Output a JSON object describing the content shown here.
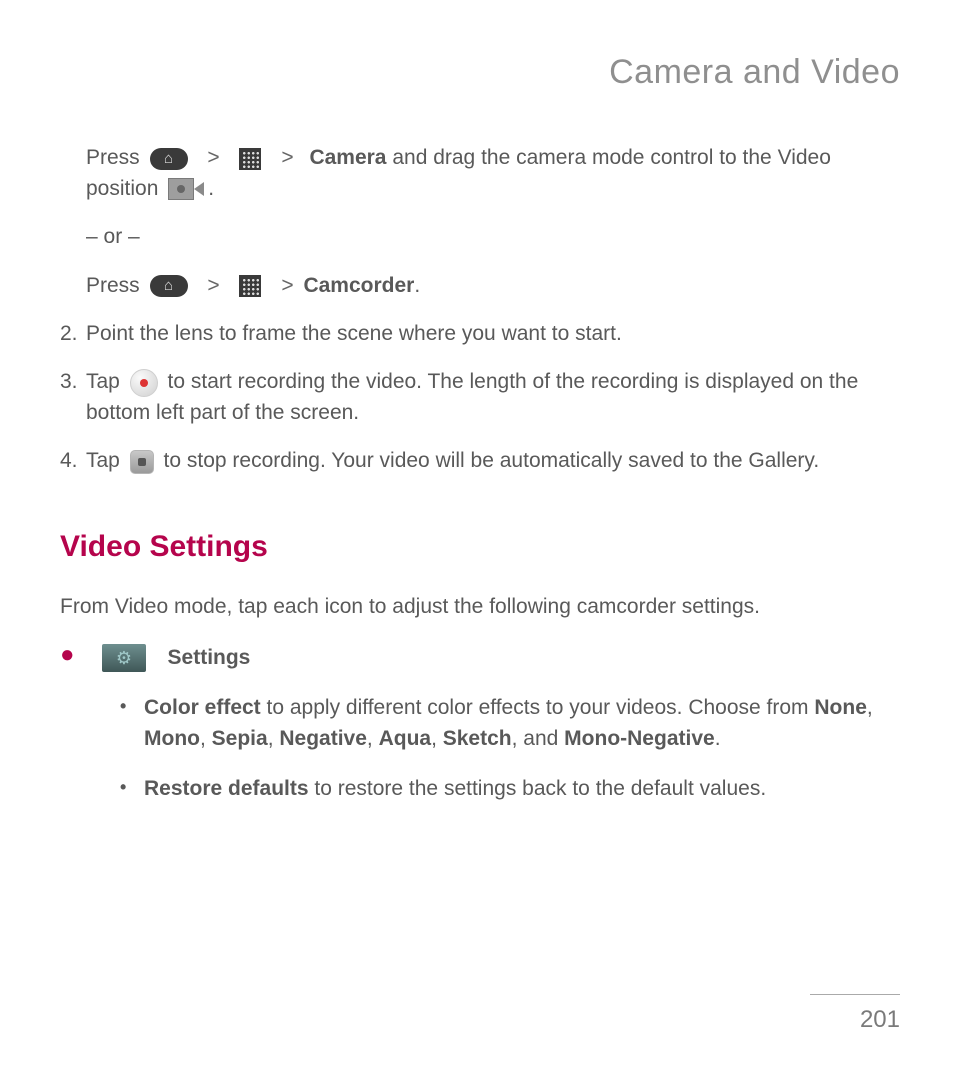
{
  "page_title": "Camera and Video",
  "step1": {
    "press_a": "Press",
    "gt": ">",
    "camera": "Camera",
    "camera_after": " and drag the camera mode control to the Video position",
    "punctuation": ".",
    "or": "– or –",
    "press_b": "Press",
    "camcorder": "Camcorder",
    "camcorder_after": "."
  },
  "step2": {
    "num": "2.",
    "text": "Point the lens to frame the scene where you want to start."
  },
  "step3": {
    "num": "3.",
    "tap": "Tap",
    "rest": " to start recording the video. The length of the recording is displayed on the bottom left part of the screen."
  },
  "step4": {
    "num": "4.",
    "tap": "Tap",
    "rest": " to stop recording. Your video will be automatically saved to the Gallery."
  },
  "video_settings_heading": "Video Settings",
  "video_settings_intro": "From Video mode, tap each icon to adjust the following camcorder settings.",
  "settings_label": "Settings",
  "color_effect": {
    "label": "Color effect",
    "text1": " to apply different color effects to your videos. Choose from ",
    "opts": [
      "None",
      "Mono",
      "Sepia",
      "Negative",
      "Aqua",
      "Sketch",
      "Mono-Negative"
    ],
    "sep": ", ",
    "and": ", and ",
    "end": "."
  },
  "restore_defaults": {
    "label": "Restore defaults",
    "text": " to restore the settings back to the default values."
  },
  "page_number": "201"
}
